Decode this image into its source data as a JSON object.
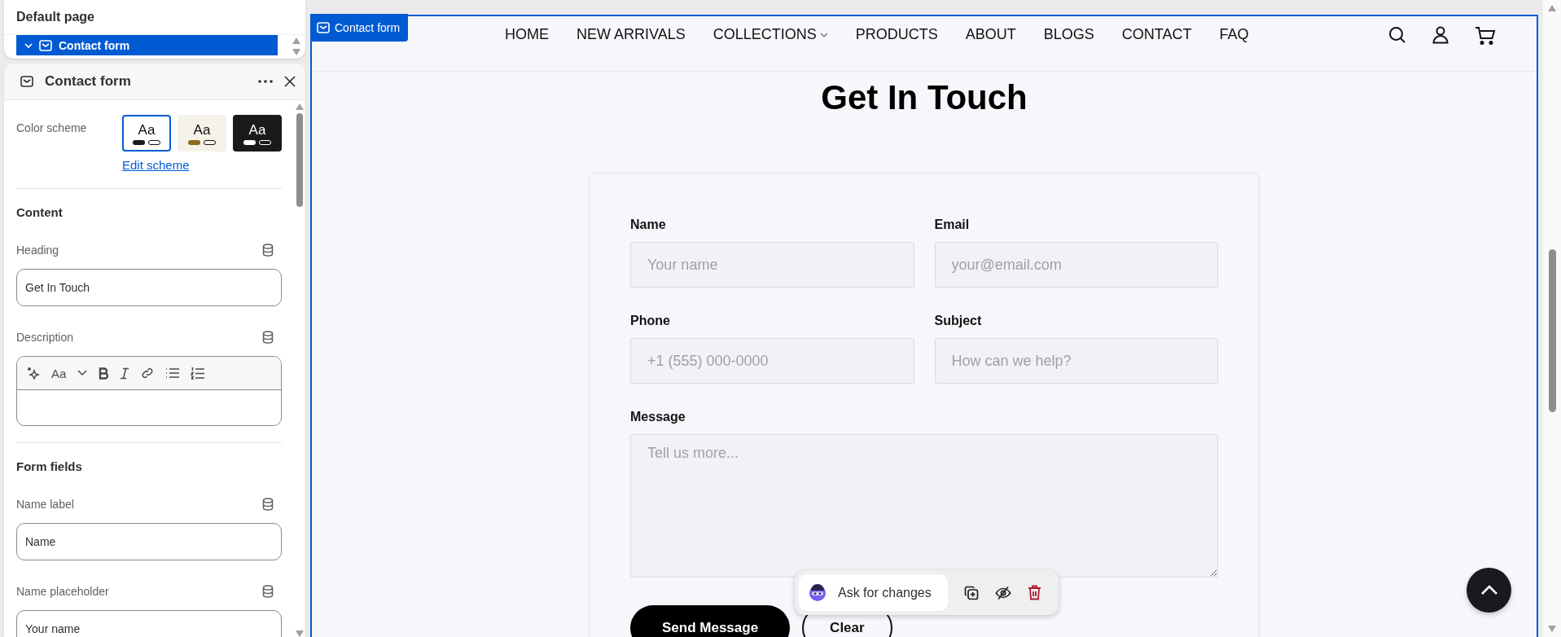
{
  "outline": {
    "title": "Default page",
    "items": [
      {
        "label": "Contact form",
        "expanded": true,
        "selected": true
      }
    ]
  },
  "settings": {
    "title": "Contact form",
    "color_scheme": {
      "label": "Color scheme",
      "link": "Edit scheme",
      "options": [
        {
          "sample": "Aa",
          "selected": true,
          "color": "#ffffff",
          "swatch": {
            "color": "#1a1a1a"
          }
        },
        {
          "sample": "Aa",
          "selected": false,
          "color": "#f5f2ea",
          "swatch": {
            "color": "#8a6d1e"
          }
        },
        {
          "sample": "Aa",
          "selected": false,
          "color": "#1a1a1a",
          "swatch": {
            "color": "#ffffff"
          }
        }
      ]
    },
    "sections": [
      {
        "title": "Content",
        "fields": [
          {
            "kind": "text",
            "label": "Heading",
            "value": "Get In Touch"
          },
          {
            "kind": "richtext",
            "label": "Description",
            "font_button": "Aa"
          }
        ]
      },
      {
        "title": "Form fields",
        "fields": [
          {
            "kind": "text",
            "label": "Name label",
            "value": "Name"
          },
          {
            "kind": "text",
            "label": "Name placeholder",
            "value": "Your name"
          }
        ]
      }
    ]
  },
  "preview": {
    "tag": "Contact form",
    "nav": [
      {
        "label": "HOME",
        "dropdown": false
      },
      {
        "label": "NEW ARRIVALS",
        "dropdown": false
      },
      {
        "label": "COLLECTIONS",
        "dropdown": true
      },
      {
        "label": "PRODUCTS",
        "dropdown": false
      },
      {
        "label": "ABOUT",
        "dropdown": false
      },
      {
        "label": "BLOGS",
        "dropdown": false
      },
      {
        "label": "CONTACT",
        "dropdown": false
      },
      {
        "label": "FAQ",
        "dropdown": false
      }
    ],
    "heading": "Get In Touch",
    "form": {
      "fields": [
        {
          "kind": "input",
          "label": "Name",
          "placeholder": "Your name"
        },
        {
          "kind": "input",
          "label": "Email",
          "placeholder": "your@email.com"
        },
        {
          "kind": "input",
          "label": "Phone",
          "placeholder": "+1 (555) 000-0000"
        },
        {
          "kind": "input",
          "label": "Subject",
          "placeholder": "How can we help?"
        },
        {
          "kind": "textarea",
          "label": "Message",
          "placeholder": "Tell us more..."
        }
      ],
      "buttons": [
        {
          "kind": "primary",
          "label": "Send Message"
        },
        {
          "kind": "secondary",
          "label": "Clear"
        }
      ]
    },
    "assistant": {
      "label": "Ask for changes"
    }
  }
}
